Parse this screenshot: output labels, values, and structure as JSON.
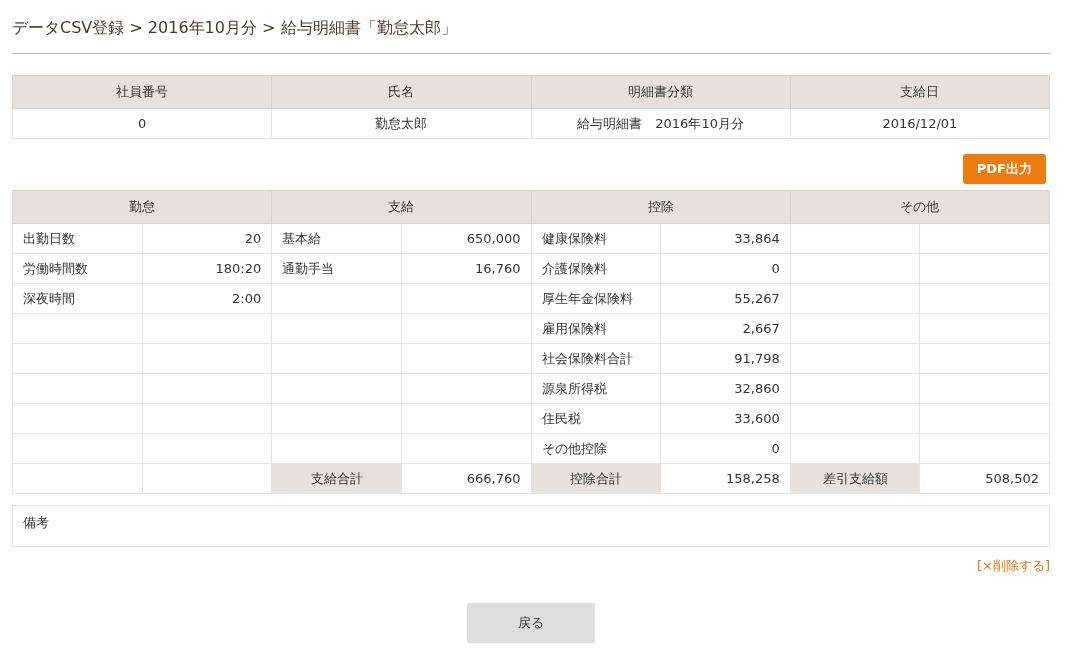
{
  "breadcrumb": "データCSV登録 > 2016年10月分 > 給与明細書「勤怠太郎」",
  "summary": {
    "columns": [
      "社員番号",
      "氏名",
      "明細書分類",
      "支給日"
    ],
    "values": [
      "0",
      "勤怠太郎",
      "給与明細書　2016年10月分",
      "2016/12/01"
    ]
  },
  "pdf_button": "PDF出力",
  "detail": {
    "sections": [
      {
        "heading": "勤怠",
        "items": [
          {
            "label": "出勤日数",
            "value": "20"
          },
          {
            "label": "労働時間数",
            "value": "180:20"
          },
          {
            "label": "深夜時間",
            "value": "2:00"
          }
        ]
      },
      {
        "heading": "支給",
        "items": [
          {
            "label": "基本給",
            "value": "650,000"
          },
          {
            "label": "通勤手当",
            "value": "16,760"
          }
        ],
        "total": {
          "label": "支給合計",
          "value": "666,760"
        }
      },
      {
        "heading": "控除",
        "items": [
          {
            "label": "健康保険料",
            "value": "33,864"
          },
          {
            "label": "介護保険料",
            "value": "0"
          },
          {
            "label": "厚生年金保険料",
            "value": "55,267"
          },
          {
            "label": "雇用保険料",
            "value": "2,667"
          },
          {
            "label": "社会保険料合計",
            "value": "91,798"
          },
          {
            "label": "源泉所得税",
            "value": "32,860"
          },
          {
            "label": "住民税",
            "value": "33,600"
          },
          {
            "label": "その他控除",
            "value": "0"
          }
        ],
        "total": {
          "label": "控除合計",
          "value": "158,258"
        }
      },
      {
        "heading": "その他",
        "total": {
          "label": "差引支給額",
          "value": "508,502"
        }
      }
    ]
  },
  "remarks": {
    "label": "備考"
  },
  "delete_link": "[×削除する]",
  "back_button": "戻る"
}
